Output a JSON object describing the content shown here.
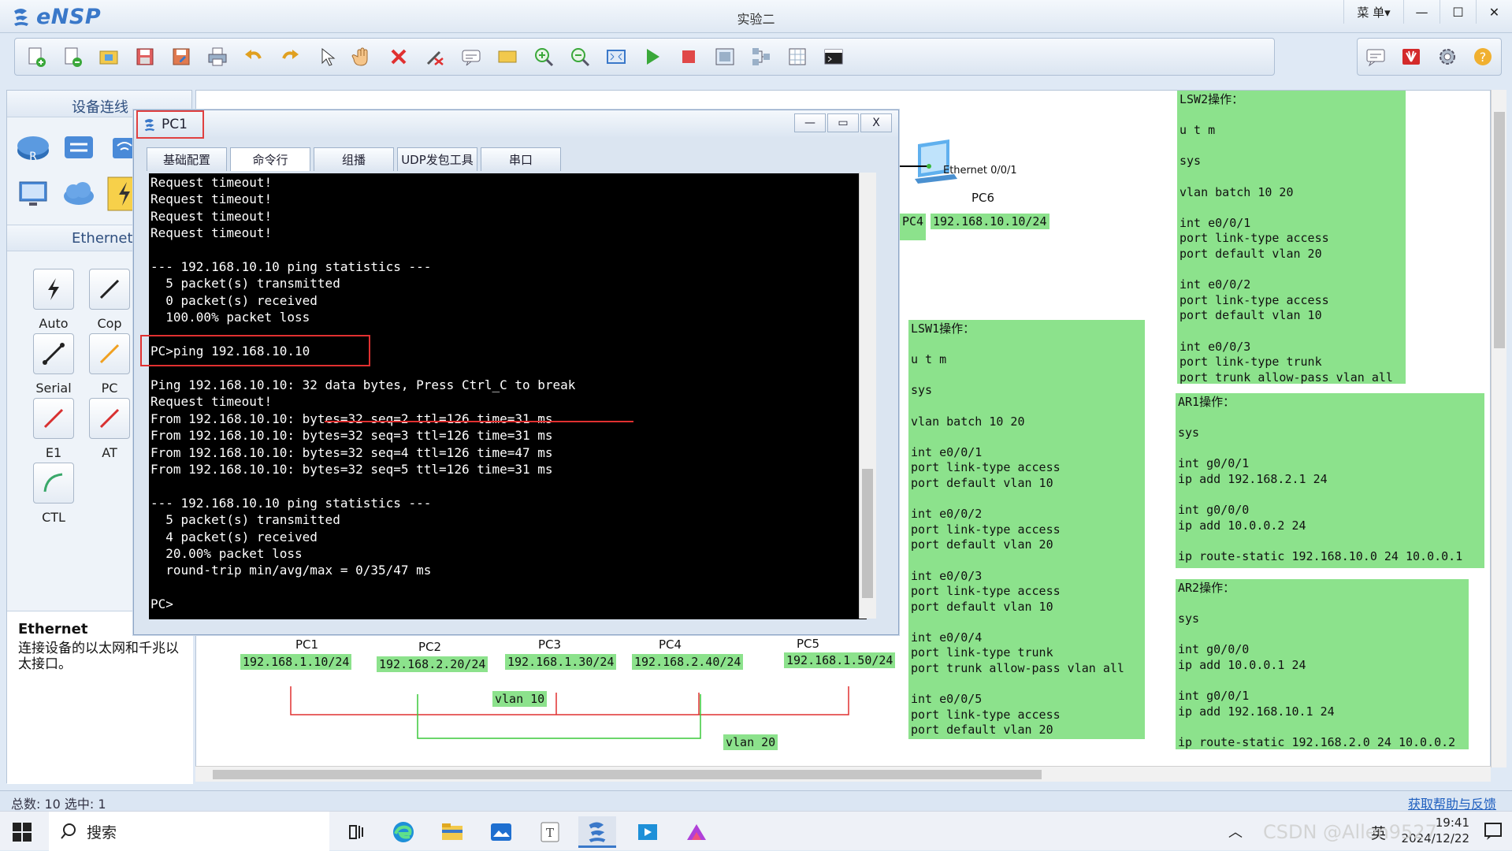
{
  "app": {
    "logo_text": "eNSP",
    "window_title": "实验二",
    "menu_label": "菜 单▾",
    "win_min": "—",
    "win_max": "☐",
    "win_close": "✕"
  },
  "toolbar": {
    "icons": [
      "new-topology-icon",
      "new-test-icon",
      "open-icon",
      "save-icon",
      "save-as-icon",
      "print-icon",
      "undo-icon",
      "redo-icon",
      "select-icon",
      "pan-hand-icon",
      "delete-icon",
      "delete-link-icon",
      "text-note-icon",
      "rectangle-icon",
      "zoom-in-icon",
      "zoom-out-icon",
      "fit-screen-icon",
      "start-device-icon",
      "stop-device-icon",
      "capture-icon",
      "topology-icon",
      "grid-icon",
      "terminal-icon"
    ],
    "right_icons": [
      "chat-icon",
      "huawei-icon",
      "settings-icon",
      "help-icon"
    ]
  },
  "left_panel": {
    "header": "设备连线",
    "ethernet_header": "Ethernet",
    "cables": [
      {
        "label": "Auto"
      },
      {
        "label": "Cop"
      },
      {
        "label": "Serial"
      },
      {
        "label": "PC"
      },
      {
        "label": "E1"
      },
      {
        "label": "AT"
      },
      {
        "label": "CTL"
      }
    ],
    "info_title": "Ethernet",
    "info_desc": "连接设备的以太网和千兆以太接口。"
  },
  "canvas": {
    "pc6": {
      "port": "Ethernet 0/0/1",
      "name": "PC6"
    },
    "pc4_tag": "PC4",
    "pc6_ip": "192.168.10.10/24",
    "lsw2": "LSW2操作：\n\nu t m\n\nsys\n\nvlan batch 10 20\n\nint e0/0/1\nport link-type access\nport default vlan 20\n\nint e0/0/2\nport link-type access\nport default vlan 10\n\nint e0/0/3\nport link-type trunk\nport trunk allow-pass vlan all",
    "lsw1": "LSW1操作：\n\nu t m\n\nsys\n\nvlan batch 10 20\n\nint e0/0/1\nport link-type access\nport default vlan 10\n\nint e0/0/2\nport link-type access\nport default vlan 20\n\nint e0/0/3\nport link-type access\nport default vlan 10\n\nint e0/0/4\nport link-type trunk\nport trunk allow-pass vlan all\n\nint e0/0/5\nport link-type access\nport default vlan 20",
    "ar1": "AR1操作：\n\nsys\n\nint g0/0/1\nip add 192.168.2.1 24\n\nint g0/0/0\nip add 10.0.0.2 24\n\nip route-static 192.168.10.0 24 10.0.0.1",
    "ar2": "AR2操作：\n\nsys\n\nint g0/0/0\nip add 10.0.0.1 24\n\nint g0/0/1\nip add 192.168.10.1 24\n\nip route-static 192.168.2.0 24 10.0.0.2",
    "pcs": [
      {
        "name": "PC1",
        "ip": "192.168.1.10/24"
      },
      {
        "name": "PC2",
        "ip": "192.168.2.20/24"
      },
      {
        "name": "PC3",
        "ip": "192.168.1.30/24"
      },
      {
        "name": "PC4",
        "ip": "192.168.2.40/24"
      },
      {
        "name": "PC5",
        "ip": "192.168.1.50/24"
      }
    ],
    "vlan10": "vlan 10",
    "vlan20": "vlan 20"
  },
  "pc_window": {
    "title": "PC1",
    "btn_min": "—",
    "btn_max": "▭",
    "btn_close": "X",
    "tabs": [
      "基础配置",
      "命令行",
      "组播",
      "UDP发包工具",
      "串口"
    ],
    "console": [
      "Request timeout!",
      "Request timeout!",
      "Request timeout!",
      "Request timeout!",
      "",
      "--- 192.168.10.10 ping statistics ---",
      "  5 packet(s) transmitted",
      "  0 packet(s) received",
      "  100.00% packet loss",
      "",
      "PC>ping 192.168.10.10",
      "",
      "Ping 192.168.10.10: 32 data bytes, Press Ctrl_C to break",
      "Request timeout!",
      "From 192.168.10.10: bytes=32 seq=2 ttl=126 time=31 ms",
      "From 192.168.10.10: bytes=32 seq=3 ttl=126 time=31 ms",
      "From 192.168.10.10: bytes=32 seq=4 ttl=126 time=47 ms",
      "From 192.168.10.10: bytes=32 seq=5 ttl=126 time=31 ms",
      "",
      "--- 192.168.10.10 ping statistics ---",
      "  5 packet(s) transmitted",
      "  4 packet(s) received",
      "  20.00% packet loss",
      "  round-trip min/avg/max = 0/35/47 ms",
      "",
      "PC>"
    ]
  },
  "status": {
    "text": "总数: 10  选中: 1",
    "help": "获取帮助与反馈"
  },
  "taskbar": {
    "search": "搜索",
    "ime": "英",
    "time": "19:41",
    "date": "2024/12/22",
    "watermark": "CSDN @Allen9527"
  }
}
